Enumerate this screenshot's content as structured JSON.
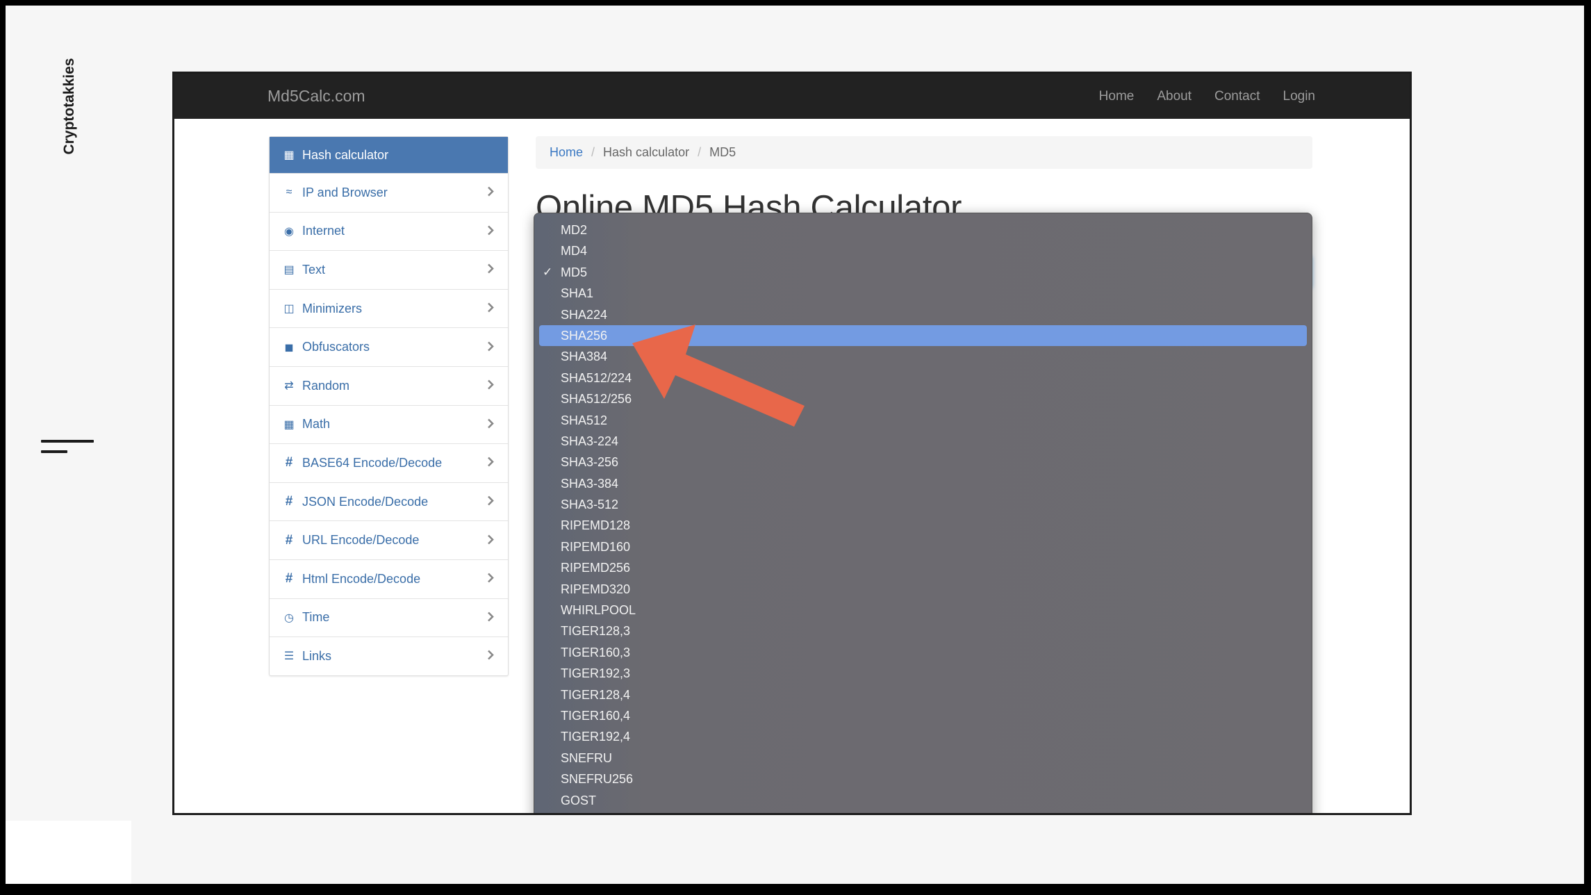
{
  "slide": {
    "brand": "Cryptotakkies",
    "menu_icon": "hamburger-icon"
  },
  "site": {
    "logo": "Md5Calc.com",
    "nav": [
      "Home",
      "About",
      "Contact",
      "Login"
    ]
  },
  "sidebar": {
    "items": [
      {
        "label": "Hash calculator",
        "icon": "calculator-icon",
        "active": true
      },
      {
        "label": "IP and Browser",
        "icon": "wifi-icon"
      },
      {
        "label": "Internet",
        "icon": "globe-icon"
      },
      {
        "label": "Text",
        "icon": "file-text-icon"
      },
      {
        "label": "Minimizers",
        "icon": "zip-file-icon"
      },
      {
        "label": "Obfuscators",
        "icon": "lock-icon"
      },
      {
        "label": "Random",
        "icon": "shuffle-icon"
      },
      {
        "label": "Math",
        "icon": "calculator-icon"
      },
      {
        "label": "BASE64 Encode/Decode",
        "icon": "hash-icon"
      },
      {
        "label": "JSON Encode/Decode",
        "icon": "hash-icon"
      },
      {
        "label": "URL Encode/Decode",
        "icon": "hash-icon"
      },
      {
        "label": "Html Encode/Decode",
        "icon": "hash-icon"
      },
      {
        "label": "Time",
        "icon": "clock-icon"
      },
      {
        "label": "Links",
        "icon": "list-icon"
      }
    ]
  },
  "breadcrumb": {
    "home": "Home",
    "section": "Hash calculator",
    "current": "MD5",
    "separator": "/"
  },
  "main": {
    "title": "Online MD5 Hash Calculator"
  },
  "dropdown": {
    "selected": "MD5",
    "highlighted": "SHA256",
    "options": [
      "MD2",
      "MD4",
      "MD5",
      "SHA1",
      "SHA224",
      "SHA256",
      "SHA384",
      "SHA512/224",
      "SHA512/256",
      "SHA512",
      "SHA3-224",
      "SHA3-256",
      "SHA3-384",
      "SHA3-512",
      "RIPEMD128",
      "RIPEMD160",
      "RIPEMD256",
      "RIPEMD320",
      "WHIRLPOOL",
      "TIGER128,3",
      "TIGER160,3",
      "TIGER192,3",
      "TIGER128,4",
      "TIGER160,4",
      "TIGER192,4",
      "SNEFRU",
      "SNEFRU256",
      "GOST"
    ]
  },
  "colors": {
    "navbar": "#222222",
    "active_sidebar": "#4a78b0",
    "link": "#3a6ea8",
    "dropdown_bg": "#6d6b70",
    "highlight": "#739be2",
    "annotation_arrow": "#e8674a"
  }
}
